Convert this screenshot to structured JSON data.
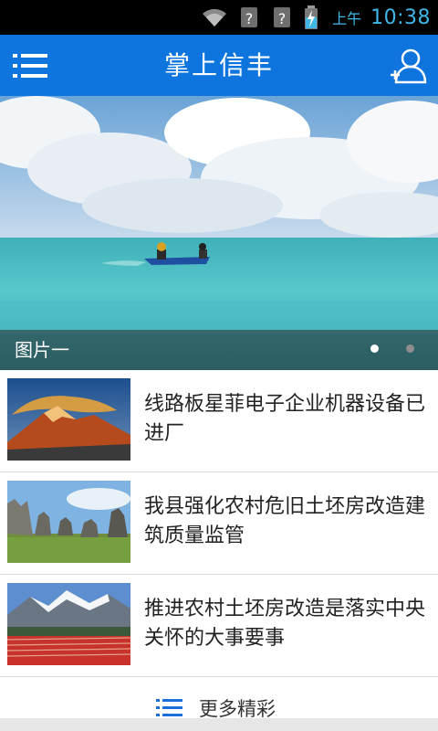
{
  "status_bar": {
    "ampm": "上午",
    "time": "10:38",
    "icons": [
      "wifi-icon",
      "signal-unknown-icon",
      "signal-unknown-icon",
      "battery-charging-icon"
    ]
  },
  "app_bar": {
    "title": "掌上信丰",
    "menu_icon": "menu-list-icon",
    "user_icon": "user-add-icon"
  },
  "banner": {
    "caption": "图片一",
    "page_count": 2,
    "active_index": 0
  },
  "news": [
    {
      "title": "线路板星菲电子企业机器设备已进厂",
      "thumb": "snow-mountain-sunset"
    },
    {
      "title": "我县强化农村危旧土坯房改造建筑质量监管",
      "thumb": "stone-forest"
    },
    {
      "title": "推进农村土坯房改造是落实中央关怀的大事要事",
      "thumb": "mountain-red-field"
    }
  ],
  "more": {
    "label": "更多精彩",
    "icon": "list-icon"
  },
  "colors": {
    "app_bar": "#0e74de",
    "status_accent": "#41b7e8",
    "caption_bar": "rgba(40,40,40,0.55)"
  }
}
